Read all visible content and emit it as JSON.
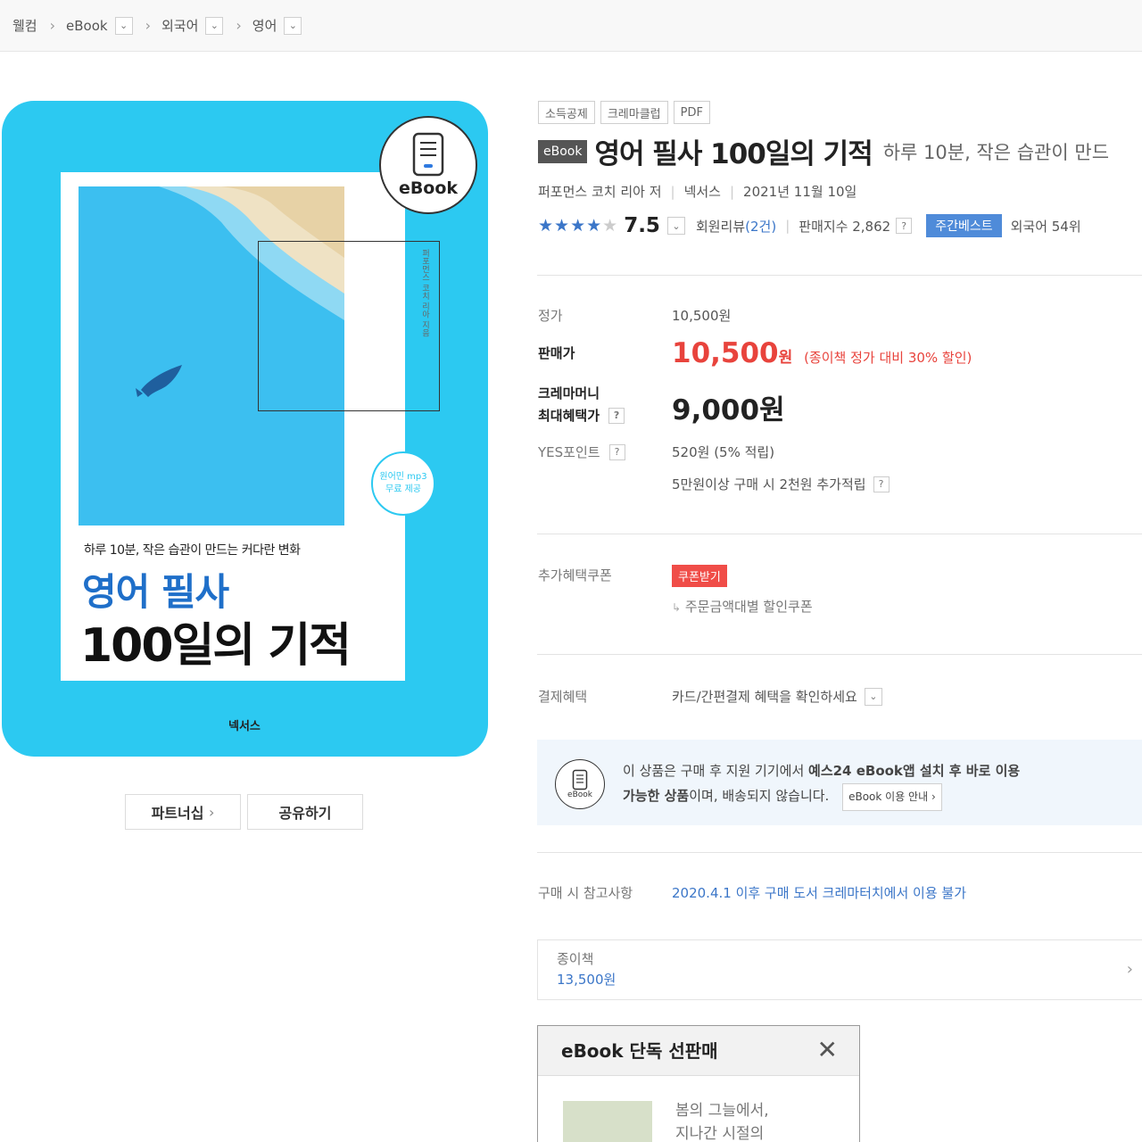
{
  "breadcrumb": {
    "items": [
      "웰컴",
      "eBook",
      "외국어",
      "영어"
    ]
  },
  "cover": {
    "badge_label": "eBook",
    "vertical_text": "퍼포먼스 코치 리아 지음",
    "stamp_line1": "원어민 mp3",
    "stamp_line2": "무료 제공",
    "subtitle": "하루 10분, 작은 습관이 만드는 커다란 변화",
    "title_line1": "영어 필사",
    "title_line2": "100일의 기적",
    "publisher": "넥서스"
  },
  "cover_buttons": {
    "partnership": "파트너십",
    "share": "공유하기"
  },
  "tags": [
    "소득공제",
    "크레마클럽",
    "PDF"
  ],
  "product": {
    "format_chip": "eBook",
    "title": "영어 필사 100일의 기적",
    "subtitle": "하루 10분, 작은 습관이 만드",
    "author": "퍼포먼스 코치 리아 저",
    "publisher": "넥서스",
    "date": "2021년 11월 10일",
    "rating": "7.5",
    "rating_stars": 4,
    "review_label": "회원리뷰",
    "review_count": "(2건)",
    "sales_label": "판매지수 2,862",
    "bestseller_tag": "주간베스트",
    "bestseller_rank": "외국어 54위"
  },
  "pricing": {
    "list_price_label": "정가",
    "list_price": "10,500원",
    "sale_price_label": "판매가",
    "sale_price": "10,500",
    "won": "원",
    "sale_note": "(종이책 정가 대비 30% 할인)",
    "crema_label_1": "크레마머니",
    "crema_label_2": "최대혜택가",
    "crema_price": "9,000",
    "points_label": "YES포인트",
    "points_value": "520원 (5% 적립)",
    "points_extra": "5만원이상 구매 시 2천원 추가적립",
    "coupon_label": "추가혜택쿠폰",
    "coupon_button": "쿠폰받기",
    "coupon_note": "주문금액대별 할인쿠폰",
    "payment_label": "결제혜택",
    "payment_value": "카드/간편결제 혜택을 확인하세요"
  },
  "notice": {
    "icon_label": "eBook",
    "text_part1": "이 상품은 구매 후 지원 기기에서 ",
    "text_bold1": "예스24 eBook앱 설치 후 바로 이용",
    "text_bold2": "가능한 상품",
    "text_part2": "이며, 배송되지 않습니다.",
    "link": "eBook 이용 안내"
  },
  "purchase_note": {
    "label": "구매 시 참고사항",
    "value": "2020.4.1 이후 구매 도서 크레마터치에서 이용 불가"
  },
  "paper_book": {
    "label": "종이책",
    "price": "13,500원"
  },
  "popup": {
    "title": "eBook 단독 선판매",
    "line1": "봄의 그늘에서,",
    "line2": "지나간 시절의"
  },
  "colors": {
    "cover_bg": "#2cc9f1",
    "accent_blue": "#3b76c8",
    "sale_red": "#e8433c",
    "best_tag": "#4f8bd9"
  }
}
